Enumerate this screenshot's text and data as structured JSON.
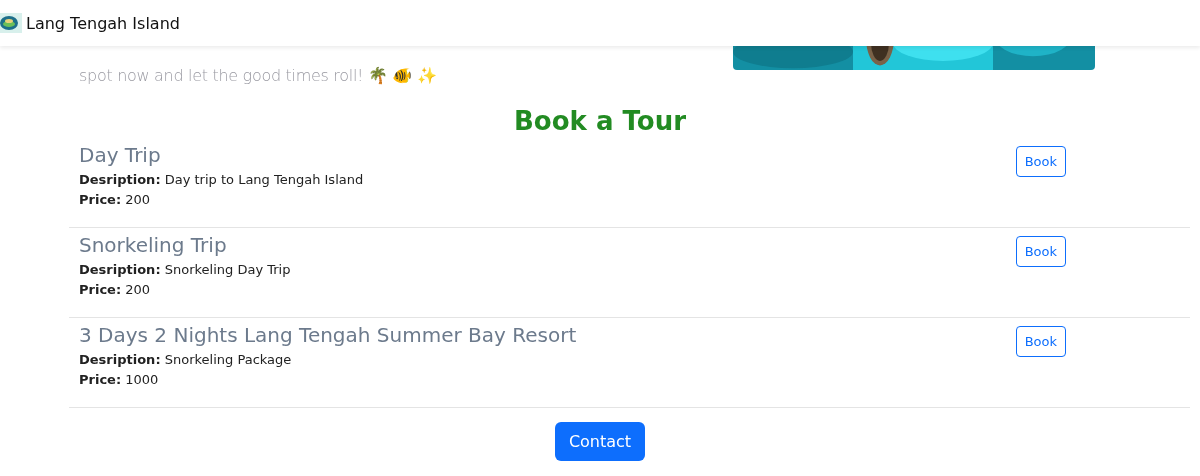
{
  "navbar": {
    "brand": "Lang Tengah Island"
  },
  "intro": {
    "lines": [
      "spot now and let the good times roll! 🌴 🐠 ✨"
    ]
  },
  "heading": "Book a Tour",
  "tours": [
    {
      "title": "Day Trip",
      "description_label": "Desription:",
      "description": "Day trip to Lang Tengah Island",
      "price_label": "Price:",
      "price": "200",
      "button": "Book"
    },
    {
      "title": "Snorkeling Trip",
      "description_label": "Desription:",
      "description": "Snorkeling Day Trip",
      "price_label": "Price:",
      "price": "200",
      "button": "Book"
    },
    {
      "title": "3 Days 2 Nights Lang Tengah Summer Bay Resort",
      "description_label": "Desription:",
      "description": "Snorkeling Package",
      "price_label": "Price:",
      "price": "1000",
      "button": "Book"
    }
  ],
  "contact_button": "Contact"
}
